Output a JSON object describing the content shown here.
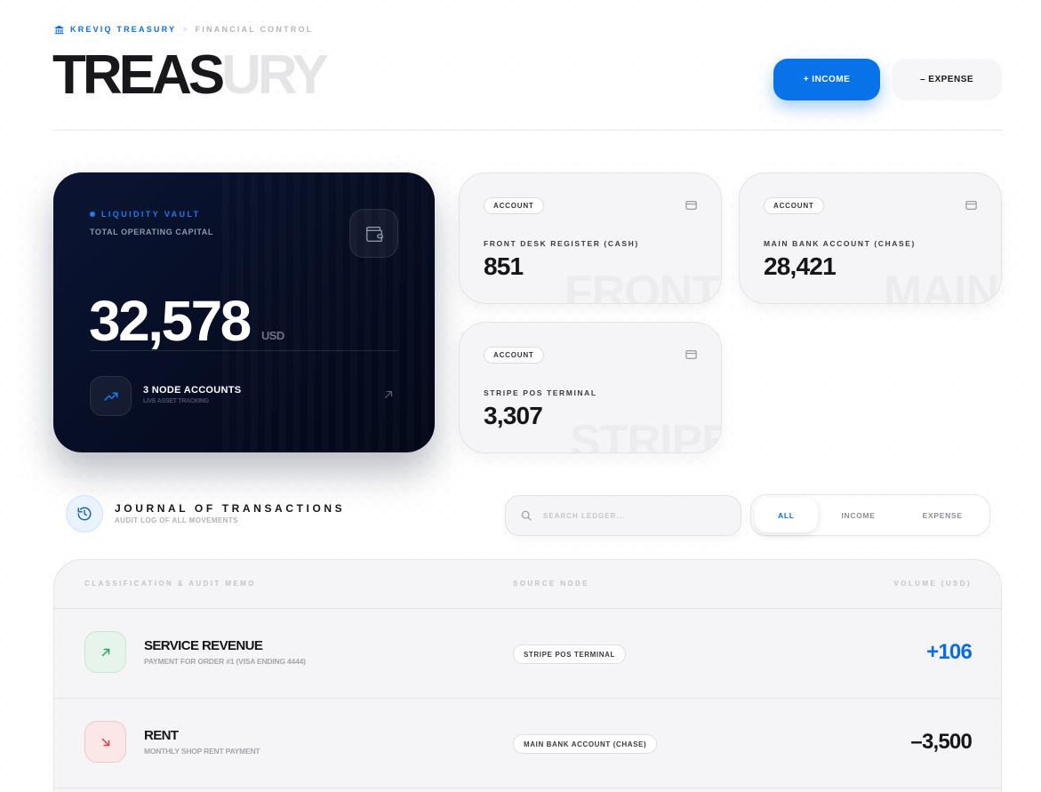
{
  "breadcrumb": {
    "brand": "KREVIQ TREASURY",
    "separator": ">",
    "section": "FINANCIAL CONTROL"
  },
  "header": {
    "title_dark": "TREAS",
    "title_light": "URY",
    "income_button": "+ INCOME",
    "expense_button": "– EXPENSE"
  },
  "vault": {
    "label": "LIQUIDITY VAULT",
    "subtitle": "TOTAL OPERATING CAPITAL",
    "amount": "32,578",
    "currency": "USD",
    "nodes_title": "3 NODE ACCOUNTS",
    "nodes_subtitle": "LIVE ASSET TRACKING"
  },
  "accounts": [
    {
      "badge": "ACCOUNT",
      "name": "FRONT DESK REGISTER (CASH)",
      "balance": "851",
      "watermark": "FRONT"
    },
    {
      "badge": "ACCOUNT",
      "name": "MAIN BANK ACCOUNT (CHASE)",
      "balance": "28,421",
      "watermark": "MAIN"
    },
    {
      "badge": "ACCOUNT",
      "name": "STRIPE POS TERMINAL",
      "balance": "3,307",
      "watermark": "STRIPE"
    }
  ],
  "journal": {
    "title": "JOURNAL OF TRANSACTIONS",
    "subtitle": "AUDIT LOG OF ALL MOVEMENTS",
    "search_placeholder": "SEARCH LEDGER...",
    "filters": [
      "ALL",
      "INCOME",
      "EXPENSE"
    ],
    "active_filter": "ALL"
  },
  "ledger": {
    "columns": [
      "CLASSIFICATION & AUDIT MEMO",
      "SOURCE NODE",
      "VOLUME (USD)"
    ],
    "rows": [
      {
        "kind": "income",
        "title": "SERVICE REVENUE",
        "memo": "PAYMENT FOR ORDER #1 (VISA ENDING 4444)",
        "source": "STRIPE POS TERMINAL",
        "amount": "+106"
      },
      {
        "kind": "expense",
        "title": "RENT",
        "memo": "MONTHLY SHOP RENT PAYMENT",
        "source": "MAIN BANK ACCOUNT (CHASE)",
        "amount": "–3,500"
      }
    ]
  },
  "colors": {
    "accent": "#0b6de0",
    "vault_bg": "#060d23",
    "income_green": "#2fa65a",
    "expense_red": "#e23b3b"
  },
  "icons": {
    "bank": "bank-icon",
    "wallet": "wallet-icon",
    "trend": "trending-up-icon",
    "arrow": "arrow-up-right-icon",
    "card": "credit-card-icon",
    "history": "history-icon",
    "search": "search-icon"
  }
}
